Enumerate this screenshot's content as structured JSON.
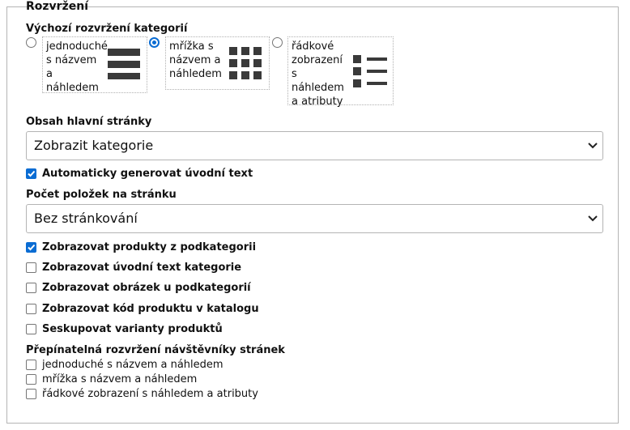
{
  "section": {
    "legend": "Rozvržení"
  },
  "layout": {
    "label": "Výchozí rozvržení kategorií",
    "options": [
      {
        "label": "jednoduché\ns názvem\na\nnáhledem",
        "icon": "list-layout-icon",
        "selected": false
      },
      {
        "label": "mřížka s\nnázvem a\nnáhledem",
        "icon": "grid-layout-icon",
        "selected": true
      },
      {
        "label": "řádkové\nzobrazení\ns\nnáhledem\na atributy",
        "icon": "rows-layout-icon",
        "selected": false
      }
    ]
  },
  "homepage": {
    "label": "Obsah hlavní stránky",
    "value": "Zobrazit kategorie"
  },
  "auto_text": {
    "label": "Automaticky generovat úvodní text",
    "checked": true
  },
  "per_page": {
    "label": "Počet položek na stránku",
    "value": "Bez stránkování"
  },
  "checkboxes": [
    {
      "label": "Zobrazovat produkty z podkategorii",
      "checked": true
    },
    {
      "label": "Zobrazovat úvodní text kategorie",
      "checked": false
    },
    {
      "label": "Zobrazovat obrázek u podkategorií",
      "checked": false
    },
    {
      "label": "Zobrazovat kód produktu v katalogu",
      "checked": false
    },
    {
      "label": "Seskupovat varianty produktů",
      "checked": false
    }
  ],
  "switchable": {
    "label": "Přepínatelná rozvržení návštěvníky stránek",
    "options": [
      {
        "label": "jednoduché s názvem a náhledem",
        "checked": false
      },
      {
        "label": "mřížka s názvem a náhledem",
        "checked": false
      },
      {
        "label": "řádkové zobrazení s náhledem a atributy",
        "checked": false
      }
    ]
  },
  "colors": {
    "accent": "#0a6cd3",
    "border": "#b4b4b4",
    "icon": "#3a3a3a"
  }
}
